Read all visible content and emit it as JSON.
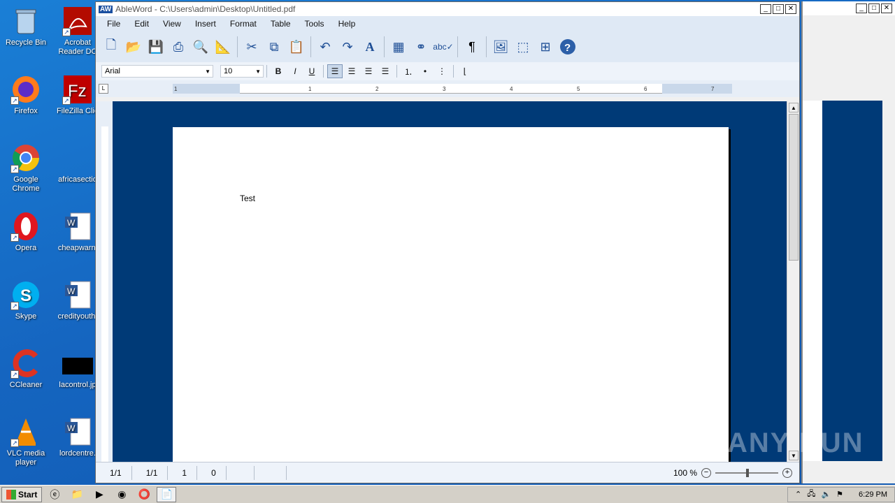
{
  "desktop": {
    "icons": [
      {
        "label": "Recycle Bin",
        "icon": "recycle-bin-icon"
      },
      {
        "label": "Acrobat Reader DC",
        "icon": "acrobat-icon"
      },
      {
        "label": "Firefox",
        "icon": "firefox-icon"
      },
      {
        "label": "FileZilla Clie",
        "icon": "filezilla-icon"
      },
      {
        "label": "Google Chrome",
        "icon": "chrome-icon"
      },
      {
        "label": "africasectio",
        "icon": "file-icon"
      },
      {
        "label": "Opera",
        "icon": "opera-icon"
      },
      {
        "label": "cheapwarni",
        "icon": "word-doc-icon"
      },
      {
        "label": "Skype",
        "icon": "skype-icon"
      },
      {
        "label": "credityouth.",
        "icon": "word-doc-icon"
      },
      {
        "label": "CCleaner",
        "icon": "ccleaner-icon"
      },
      {
        "label": "lacontrol.jp",
        "icon": "image-icon"
      },
      {
        "label": "VLC media player",
        "icon": "vlc-icon"
      },
      {
        "label": "lordcentre.",
        "icon": "word-doc-icon"
      }
    ]
  },
  "window": {
    "logo": "AW",
    "title": "AbleWord - C:\\Users\\admin\\Desktop\\Untitled.pdf",
    "menu": [
      "File",
      "Edit",
      "View",
      "Insert",
      "Format",
      "Table",
      "Tools",
      "Help"
    ],
    "font_name": "Arial",
    "font_size": "10",
    "format_buttons": {
      "bold": "B",
      "italic": "I",
      "underline": "U"
    },
    "ruler_ticks": [
      "1",
      "1",
      "2",
      "3",
      "4",
      "5",
      "6",
      "7"
    ],
    "document_text": "Test",
    "status": {
      "page": "1/1",
      "section": "1/1",
      "line": "1",
      "col": "0",
      "zoom": "100 %"
    }
  },
  "taskbar": {
    "start_label": "Start",
    "clock": "6:29 PM"
  },
  "watermark": "ANY RUN"
}
